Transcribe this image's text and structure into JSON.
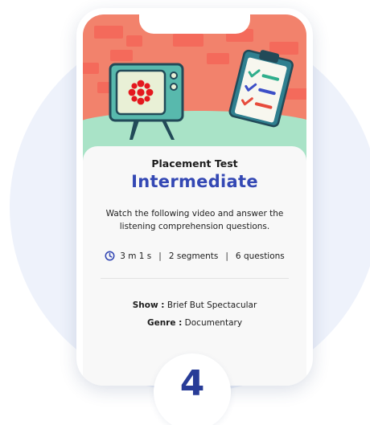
{
  "test": {
    "label": "Placement Test",
    "level": "Intermediate",
    "description": "Watch the following video and answer the listening comprehension questions."
  },
  "stats": {
    "duration": "3 m 1 s",
    "separator": "|",
    "segments": "2 segments",
    "questions": "6 questions"
  },
  "details": {
    "show_label": "Show :",
    "show_value": "Brief But Spectacular",
    "genre_label": "Genre :",
    "genre_value": "Documentary"
  },
  "step_number": "4",
  "colors": {
    "accent": "#3448b4",
    "wall": "#f2826c",
    "floor": "#a9e3c7",
    "tv": "#58b9ad",
    "check_blue": "#3c4fc7",
    "check_green": "#2fae8c",
    "check_red": "#e74b3c",
    "cbc_red": "#e4181e"
  },
  "icons": {
    "tv": "tv-illustration",
    "checklist": "clipboard-checklist-illustration",
    "clock": "clock-icon",
    "logo": "cbc-logo-icon"
  }
}
